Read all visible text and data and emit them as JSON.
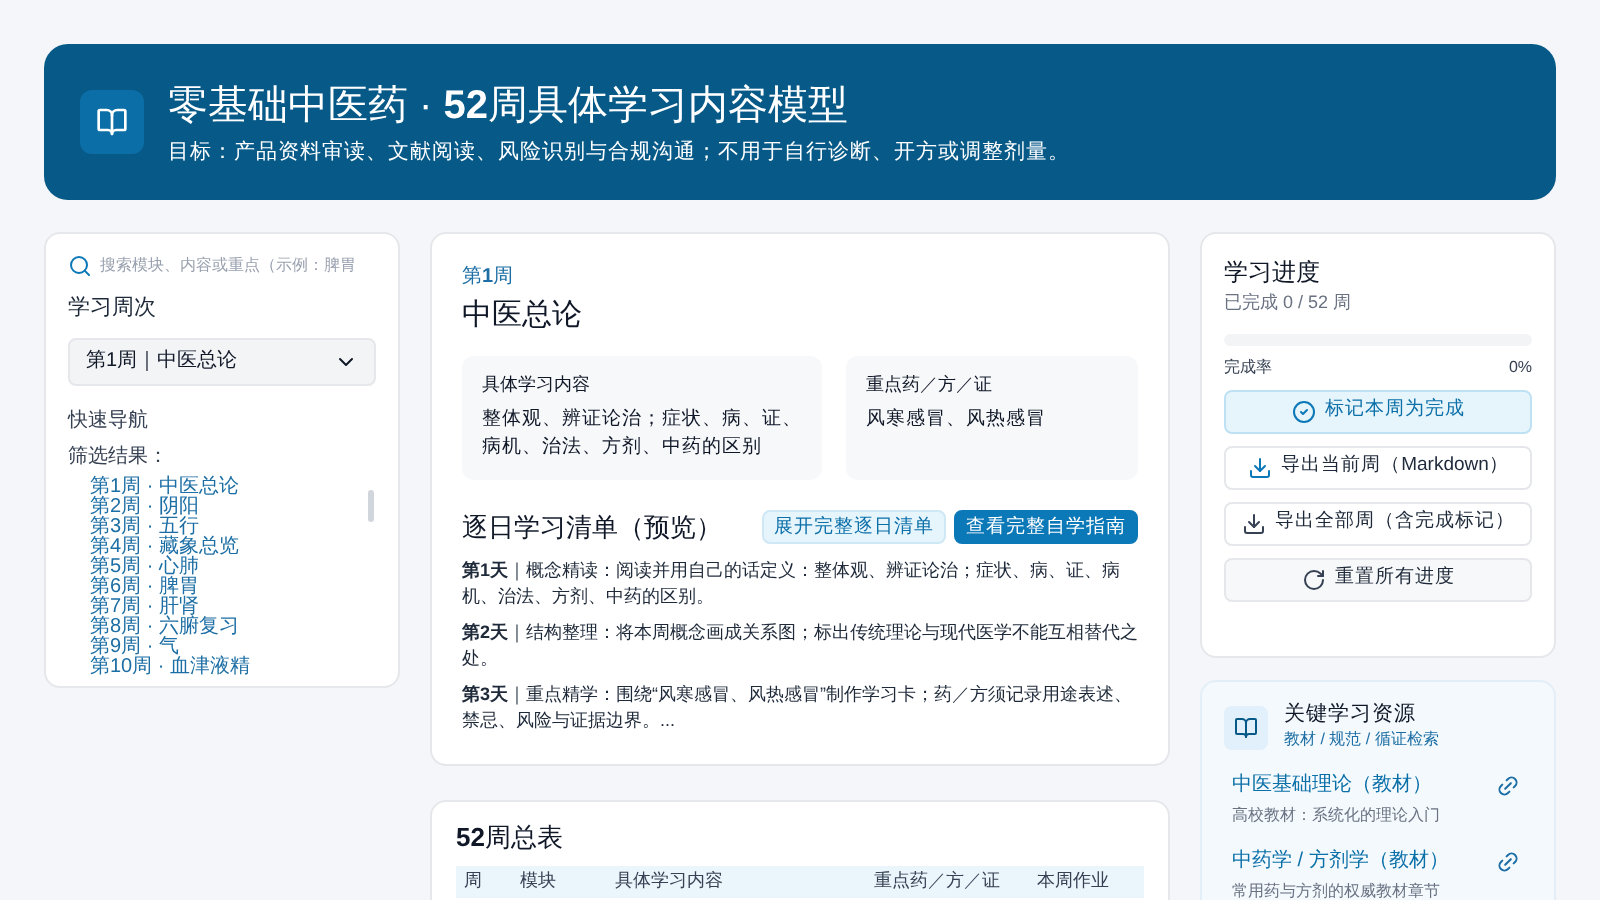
{
  "header": {
    "title": "零基础中医药 · **52**周具体学习内容模型",
    "subtitle": "目标：产品资料审读、文献阅读、风险识别与合规沟通；不用于自行诊断、开方或调整剂量。"
  },
  "sidebar": {
    "search": {
      "placeholder": "搜索模块、内容或重点（示例：脾胃"
    },
    "week_label": "学习周次",
    "select": {
      "value": "第1周｜中医总论"
    },
    "quick_nav_label": "快速导航",
    "filter_label": "筛选结果：",
    "results": [
      "第1周 · 中医总论",
      "第2周 · 阴阳",
      "第3周 · 五行",
      "第4周 · 藏象总览",
      "第5周 · 心肺",
      "第6周 · 脾胃",
      "第7周 · 肝肾",
      "第8周 · 六腑复习",
      "第9周 · 气",
      "第10周 · 血津液精"
    ]
  },
  "week": {
    "week_label": "第**1**周",
    "title": "中医总论",
    "boxes": [
      {
        "label": "具体学习内容",
        "text": "整体观、辨证论治；症状、病、证、病机、治法、方剂、中药的区别"
      },
      {
        "label": "重点药／方／证",
        "text": "风寒感冒、风热感冒"
      }
    ],
    "daily": {
      "title": "逐日学习清单（预览）",
      "buttons": [
        {
          "label": "展开完整逐日清单",
          "kind": "secondary"
        },
        {
          "label": "查看完整自学指南",
          "kind": "primary"
        }
      ],
      "items": [
        "**第1天**｜概念精读：阅读并用自己的话定义：整体观、辨证论治；症状、病、证、病机、治法、方剂、中药的区别。",
        "**第2天**｜结构整理：将本周概念画成关系图；标出传统理论与现代医学不能互相替代之处。",
        "**第3天**｜重点精学：围绕“风寒感冒、风热感冒”制作学习卡；药／方须记录用途表述、禁忌、风险与证据边界。..."
      ]
    }
  },
  "table": {
    "title": "**52**周总表",
    "columns": [
      "周",
      "模块",
      "具体学习内容",
      "重点药／方／证",
      "本周作业"
    ]
  },
  "progress": {
    "title": "学习进度",
    "summary": "已完成 0 / 52 周",
    "level": 0,
    "rate_label": "完成率",
    "rate_value": "0%",
    "actions": [
      {
        "label": "标记本周为完成",
        "kind": "complete"
      },
      {
        "label": "导出当前周（Markdown）",
        "kind": "export_current"
      },
      {
        "label": "导出全部周（含完成标记）",
        "kind": "export_all"
      },
      {
        "label": "重置所有进度",
        "kind": "reset"
      }
    ]
  },
  "resources": {
    "title": "关键学习资源",
    "subtitle": "教材 / 规范 / 循证检索",
    "items": [
      {
        "title": "中医基础理论（教材）",
        "description": "高校教材：系统化的理论入门"
      },
      {
        "title": "中药学 / 方剂学（教材）",
        "description": "常用药与方剂的权威教材章节"
      }
    ]
  }
}
